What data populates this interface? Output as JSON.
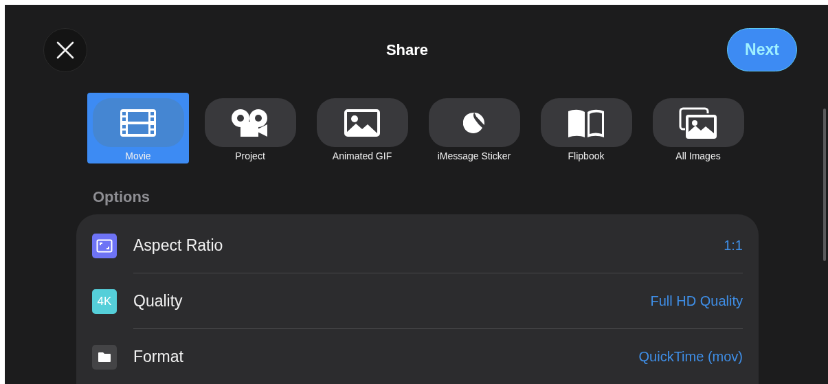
{
  "header": {
    "title": "Share",
    "next_button": "Next"
  },
  "share_types": [
    {
      "label": "Movie",
      "kind": "film",
      "selected": true
    },
    {
      "label": "Project",
      "kind": "projector",
      "selected": false
    },
    {
      "label": "Animated GIF",
      "kind": "image",
      "selected": false
    },
    {
      "label": "iMessage Sticker",
      "kind": "sticker",
      "selected": false
    },
    {
      "label": "Flipbook",
      "kind": "book",
      "selected": false
    },
    {
      "label": "All Images",
      "kind": "images",
      "selected": false
    }
  ],
  "options": {
    "heading": "Options",
    "rows": [
      {
        "label": "Aspect Ratio",
        "value": "1:1",
        "kind": "aspect",
        "color": "#6e73f5"
      },
      {
        "label": "Quality",
        "value": "Full HD Quality",
        "kind": "badge",
        "badge": "4K",
        "color": "#55cfd9"
      },
      {
        "label": "Format",
        "value": "QuickTime (mov)",
        "kind": "folder",
        "color": "#444446"
      }
    ]
  }
}
